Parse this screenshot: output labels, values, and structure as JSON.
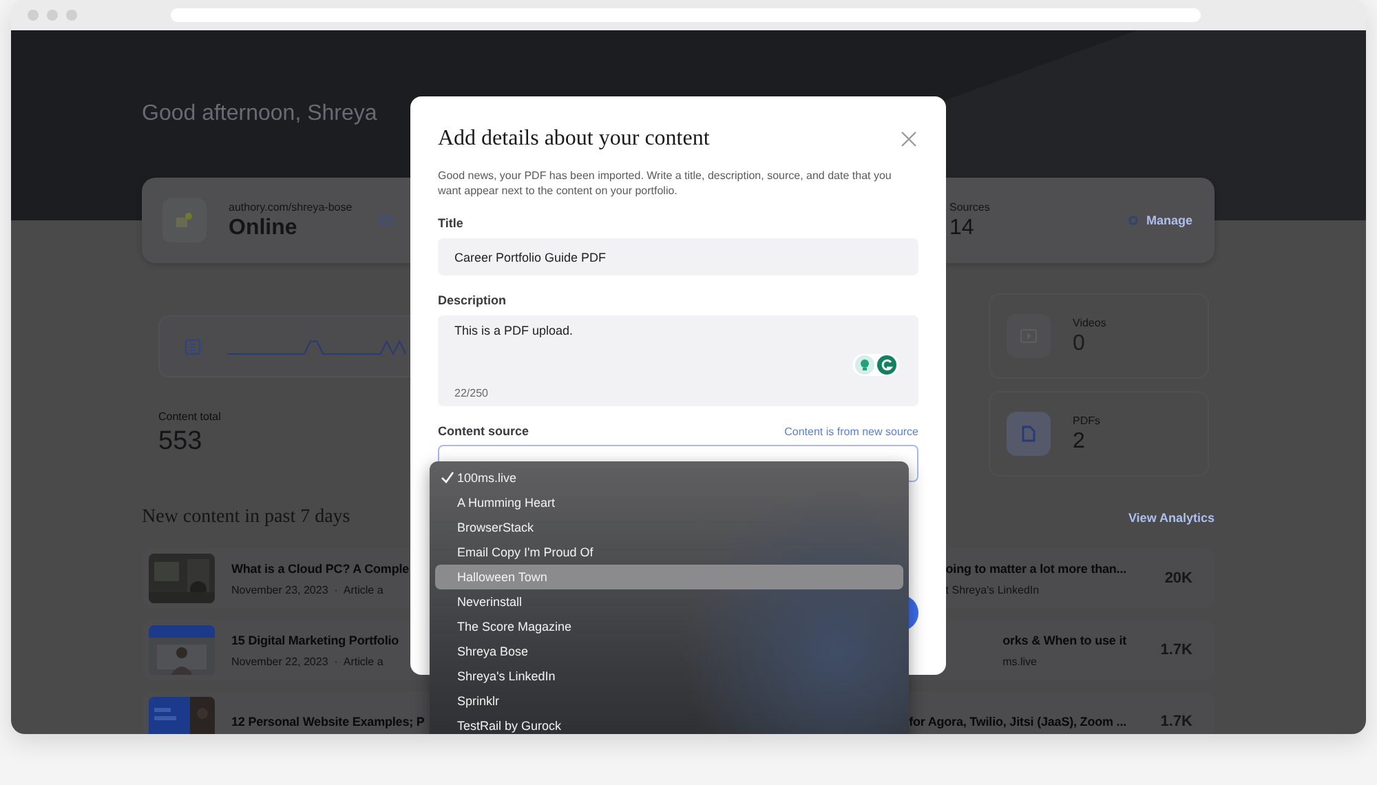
{
  "greeting": "Good afternoon, Shreya",
  "profile": {
    "url": "authory.com/shreya-bose",
    "status": "Online",
    "sources_label": "Sources",
    "sources_count": "14",
    "manage_link": "Manage"
  },
  "stats": {
    "total_label": "Content total",
    "total": "553",
    "cards": [
      {
        "kind": "video",
        "label": "Videos",
        "value": "0"
      },
      {
        "kind": "pdf",
        "label": "PDFs",
        "value": "2"
      }
    ]
  },
  "new_content": {
    "heading": "New content in past 7 days",
    "link": "View Analytics",
    "rows": [
      {
        "title_start": "What is a Cloud PC? A Comple",
        "meta_start": "November 23, 2023  ·  Article a",
        "title_end": "oing to matter a lot more than...",
        "meta_end": "t Shreya's LinkedIn",
        "count": "20K"
      },
      {
        "title_start": "15 Digital Marketing Portfolio",
        "meta_start": "November 22, 2023  ·  Article a",
        "title_end": "orks & When to use it",
        "meta_end": "ms.live",
        "count": "1.7K"
      },
      {
        "title_start": "12 Personal Website Examples; P",
        "title_end": "for Agora, Twilio, Jitsi (JaaS), Zoom ...",
        "count": "1.7K"
      }
    ]
  },
  "modal": {
    "title": "Add details about your content",
    "intro": "Good news, your PDF has been imported. Write a title, description, source, and date that you want appear next to the content on your portfolio.",
    "title_field": {
      "label": "Title",
      "value": "Career Portfolio Guide PDF"
    },
    "description_field": {
      "label": "Description",
      "value": "This is a PDF upload.",
      "counter": "22/250"
    },
    "source_field": {
      "label": "Content source",
      "link": "Content is from new source"
    }
  },
  "dropdown": {
    "options": [
      {
        "label": "100ms.live",
        "selected": true,
        "highlighted": false
      },
      {
        "label": "A Humming Heart",
        "selected": false,
        "highlighted": false
      },
      {
        "label": "BrowserStack",
        "selected": false,
        "highlighted": false
      },
      {
        "label": "Email Copy I'm Proud Of",
        "selected": false,
        "highlighted": false
      },
      {
        "label": "Halloween Town",
        "selected": false,
        "highlighted": true
      },
      {
        "label": "Neverinstall",
        "selected": false,
        "highlighted": false
      },
      {
        "label": "The Score Magazine",
        "selected": false,
        "highlighted": false
      },
      {
        "label": "Shreya Bose",
        "selected": false,
        "highlighted": false
      },
      {
        "label": "Shreya's LinkedIn",
        "selected": false,
        "highlighted": false
      },
      {
        "label": "Sprinklr",
        "selected": false,
        "highlighted": false
      },
      {
        "label": "TestRail by Gurock",
        "selected": false,
        "highlighted": false
      }
    ]
  }
}
